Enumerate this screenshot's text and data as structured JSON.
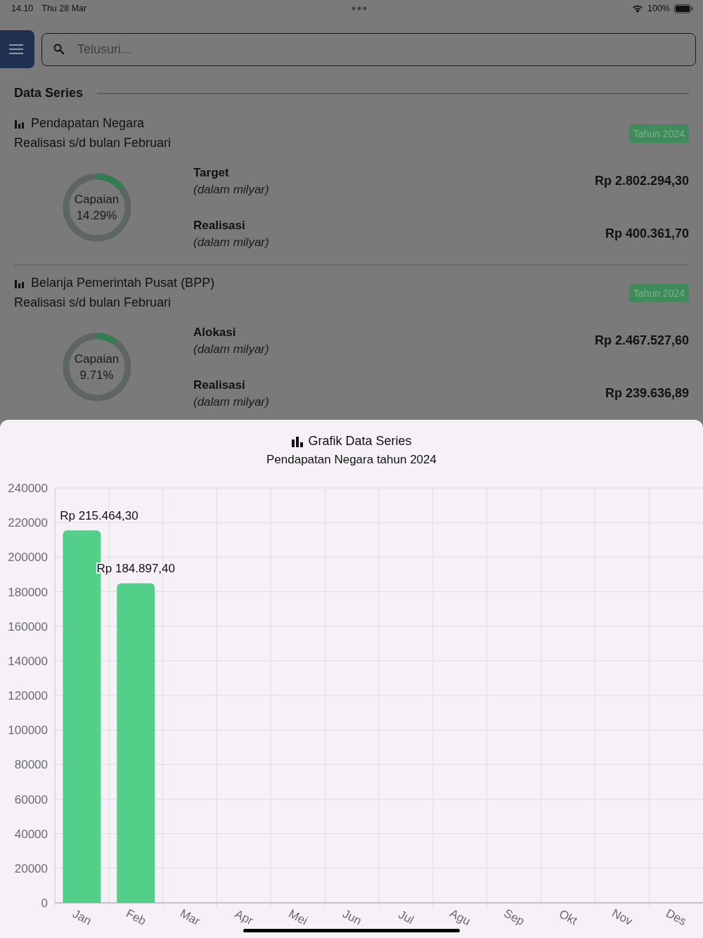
{
  "status_bar": {
    "time": "14.10",
    "date": "Thu 28 Mar",
    "battery": "100%"
  },
  "search": {
    "placeholder": "Telusuri..."
  },
  "section": {
    "title": "Data Series"
  },
  "cards": [
    {
      "title": "Pendapatan Negara",
      "subtitle": "Realisasi s/d bulan Februari",
      "badge": "Tahun 2024",
      "gauge": {
        "label": "Capaian",
        "value": "14.29%",
        "level": 0.1429
      },
      "rows": [
        {
          "label": "Target",
          "unit": "(dalam milyar)",
          "amount": "Rp 2.802.294,30"
        },
        {
          "label": "Realisasi",
          "unit": "(dalam milyar)",
          "amount": "Rp 400.361,70"
        }
      ]
    },
    {
      "title": "Belanja Pemerintah Pusat (BPP)",
      "subtitle": "Realisasi s/d bulan Februari",
      "badge": "Tahun 2024",
      "gauge": {
        "label": "Capaian",
        "value": "9.71%",
        "level": 0.0971
      },
      "rows": [
        {
          "label": "Alokasi",
          "unit": "(dalam milyar)",
          "amount": "Rp 2.467.527,60"
        },
        {
          "label": "Realisasi",
          "unit": "(dalam milyar)",
          "amount": "Rp 239.636,89"
        }
      ]
    }
  ],
  "sheet": {
    "title": "Grafik Data Series",
    "subtitle": "Pendapatan Negara tahun 2024",
    "chart_data": {
      "type": "bar",
      "categories": [
        "Jan",
        "Feb",
        "Mar",
        "Apr",
        "Mei",
        "Jun",
        "Jul",
        "Agu",
        "Sep",
        "Okt",
        "Nov",
        "Des"
      ],
      "grid": true,
      "series": [
        {
          "color": "#52cf88",
          "values": [
            215464.3,
            184897.4,
            null,
            null,
            null,
            null,
            null,
            null,
            null,
            null,
            null,
            null
          ]
        }
      ],
      "value_labels": [
        "Rp 215.464,30",
        "Rp 184.897,40",
        null,
        null,
        null,
        null,
        null,
        null,
        null,
        null,
        null,
        null
      ],
      "ylim": [
        0,
        240000
      ],
      "yticks": [
        0,
        20000,
        40000,
        60000,
        80000,
        100000,
        120000,
        140000,
        160000,
        180000,
        200000,
        220000,
        240000
      ]
    }
  }
}
